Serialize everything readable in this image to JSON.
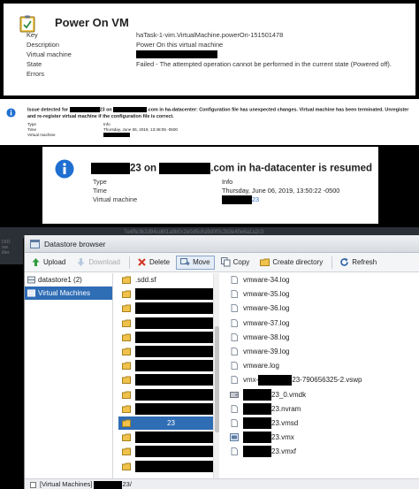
{
  "task_panel": {
    "title": "Power On VM",
    "rows": [
      {
        "key": "Key",
        "value": "haTask-1-vim.VirtualMachine.powerOn-151501478"
      },
      {
        "key": "Description",
        "value": "Power On this virtual machine"
      },
      {
        "key": "Virtual machine",
        "value": ""
      },
      {
        "key": "State",
        "value": "Failed - The attempted operation cannot be performed in the current state (Powered off)."
      },
      {
        "key": "Errors",
        "value": ""
      }
    ]
  },
  "issue_panel": {
    "message_start": "Issue detected for",
    "message_mid": "23 on",
    "message_end": ".com in ha-datacenter: Configuration file has unexpected changes. Virtual machine has been terminated. Unregister and re-register virtual machine if the configuration file is correct.",
    "rows": [
      {
        "key": "Type",
        "value": "Info"
      },
      {
        "key": "Time",
        "value": "Thursday, June 06, 2019, 13:48:05 -0500"
      },
      {
        "key": "Virtual machine",
        "value": ""
      }
    ]
  },
  "resumed_panel": {
    "title_mid": "23 on",
    "title_end": ".com in ha-datacenter is resumed",
    "rows": [
      {
        "key": "Type",
        "value": "Info"
      },
      {
        "key": "Time",
        "value": "Thursday, June 06, 2019, 13:50:22 -0500"
      },
      {
        "key": "Virtual machine",
        "value": "23"
      }
    ]
  },
  "background": {
    "ghost_text": "7e4ffe3b2d94cd6f1a8b0c2e0d5c8a9d0f0c2b3e40e6a1a2c3",
    "left_lines": [
      "DID",
      "ow",
      "ilter"
    ]
  },
  "datastore_browser": {
    "title": "Datastore browser",
    "toolbar": {
      "upload": "Upload",
      "download": "Download",
      "delete": "Delete",
      "move": "Move",
      "copy": "Copy",
      "create_directory": "Create directory",
      "refresh": "Refresh"
    },
    "datastores": [
      {
        "label": "datastore1 (2)"
      },
      {
        "label": "Virtual Machines"
      }
    ],
    "folders": [
      {
        "label": ".sdd.sf"
      },
      {
        "label": ""
      },
      {
        "label": ""
      },
      {
        "label": ""
      },
      {
        "label": ""
      },
      {
        "label": ""
      },
      {
        "label": ""
      },
      {
        "label": ""
      },
      {
        "label": ""
      },
      {
        "label": ""
      },
      {
        "label": "23"
      },
      {
        "label": ""
      },
      {
        "label": ""
      },
      {
        "label": ""
      }
    ],
    "files": [
      {
        "label": "vmware-34.log"
      },
      {
        "label": "vmware-35.log"
      },
      {
        "label": "vmware-36.log"
      },
      {
        "label": "vmware-37.log"
      },
      {
        "label": "vmware-38.log"
      },
      {
        "label": "vmware-39.log"
      },
      {
        "label": "vmware.log"
      },
      {
        "label_start": "vmx-",
        "label_end": "23-790656325-2.vswp"
      },
      {
        "label": "23_0.vmdk"
      },
      {
        "label": "23.nvram"
      },
      {
        "label": "23.vmsd"
      },
      {
        "label": "23.vmx"
      },
      {
        "label": "23.vmxf"
      }
    ],
    "status_path_start": "[Virtual Machines]",
    "status_path_end": "23/"
  }
}
